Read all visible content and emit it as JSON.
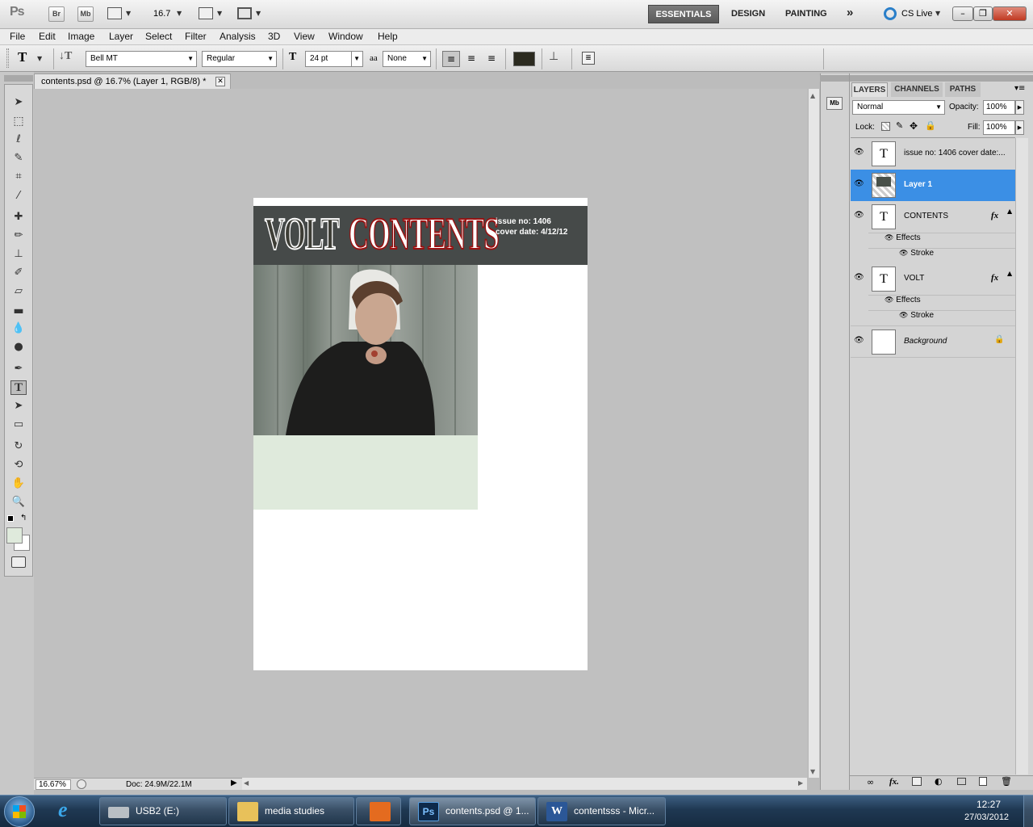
{
  "app": {
    "logo": "Ps",
    "br": "Br",
    "mb": "Mb",
    "zoom_combo": "16.7",
    "workspaces": [
      "ESSENTIALS",
      "DESIGN",
      "PAINTING"
    ],
    "more": "»",
    "cs_live": "CS Live"
  },
  "menu": [
    "File",
    "Edit",
    "Image",
    "Layer",
    "Select",
    "Filter",
    "Analysis",
    "3D",
    "View",
    "Window",
    "Help"
  ],
  "options": {
    "font_family": "Bell MT",
    "font_style": "Regular",
    "font_size": "24 pt",
    "aa_label": "aa",
    "antialias": "None",
    "text_color": "#2b2a1f"
  },
  "document": {
    "tab_title": "contents.psd @ 16.7% (Layer 1, RGB/8) *",
    "zoom_status": "16.67%",
    "doc_size": "Doc: 24.9M/22.1M"
  },
  "artwork": {
    "title_left": "VOLT",
    "title_right": "CONTENTS",
    "issue_line": "issue no: 1406",
    "cover_date_line": "cover date: 4/12/12"
  },
  "panel": {
    "tabs": [
      "LAYERS",
      "CHANNELS",
      "PATHS"
    ],
    "blend_mode": "Normal",
    "opacity_label": "Opacity:",
    "opacity": "100%",
    "lock_label": "Lock:",
    "fill_label": "Fill:",
    "fill": "100%",
    "layers": [
      {
        "name": "issue no: 1406 cover date:...",
        "thumb": "T"
      },
      {
        "name": "Layer 1",
        "thumb": ""
      },
      {
        "name": "CONTENTS",
        "thumb": "T",
        "fx": "fx"
      },
      {
        "name": "VOLT",
        "thumb": "T",
        "fx": "fx"
      },
      {
        "name": "Background",
        "thumb": ""
      }
    ],
    "effects_label": "Effects",
    "stroke_label": "Stroke"
  },
  "taskbar": {
    "items": [
      "USB2 (E:)",
      "media studies",
      "contents.psd @ 1...",
      "contentsss - Micr..."
    ],
    "time": "12:27",
    "date": "27/03/2012"
  }
}
